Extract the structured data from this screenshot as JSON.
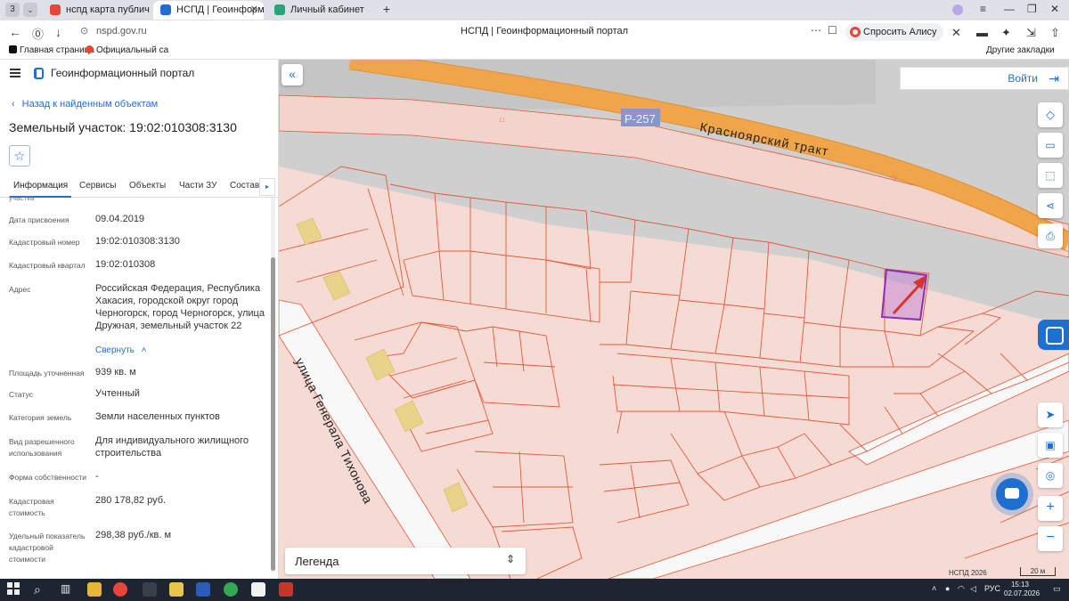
{
  "browser": {
    "tab_count": "3",
    "tabs": [
      {
        "label": "нспд карта публичная кад",
        "active": false
      },
      {
        "label": "НСПД | Геоинформаци",
        "active": true
      },
      {
        "label": "Личный кабинет",
        "active": false
      }
    ],
    "url": "nspd.gov.ru",
    "page_title": "НСПД | Геоинформационный портал",
    "alice_label": "Спросить Алису AI",
    "bookmarks": [
      {
        "label": "Главная страница"
      },
      {
        "label": "Официальный са"
      }
    ],
    "other_bookmarks": "Другие закладки"
  },
  "panel": {
    "portal_title": "Геоинформационный портал",
    "back_link": "Назад к найденным объектам",
    "parcel_title": "Земельный участок: 19:02:010308:3130",
    "tabs": [
      "Информация",
      "Сервисы",
      "Объекты",
      "Части ЗУ",
      "Состав"
    ],
    "clipped_label": "участка",
    "fields": [
      {
        "label": "Дата присвоения",
        "value": "09.04.2019"
      },
      {
        "label": "Кадастровый номер",
        "value": "19:02:010308:3130"
      },
      {
        "label": "Кадастровый квартал",
        "value": "19:02:010308"
      },
      {
        "label": "Адрес",
        "value": "Российская Федерация, Республика Хакасия, городской округ город Черногорск, город Черногорск, улица Дружная, земельный участок 22"
      },
      {
        "label": "Площадь уточненная",
        "value": "939 кв. м"
      },
      {
        "label": "Статус",
        "value": "Учтенный"
      },
      {
        "label": "Категория земель",
        "value": "Земли населенных пунктов"
      },
      {
        "label": "Вид разрешенного использования",
        "value": "Для индивидуального жилищного строительства"
      },
      {
        "label": "Форма собственности",
        "value": "-"
      },
      {
        "label": "Кадастровая стоимость",
        "value": "280 178,82 руб."
      },
      {
        "label": "Удельный показатель кадастровой стоимости",
        "value": "298,38 руб./кв. м"
      }
    ],
    "collapse_label": "Свернуть"
  },
  "map": {
    "login_label": "Войти",
    "road_badge": "Р-257",
    "road_name": "Красноярский тракт",
    "street_name": "улица Генерала Тихонова",
    "legend_label": "Легенда",
    "copyright": "НСПД 2026",
    "scale": "20 м",
    "colors": {
      "parcel_line": "#e05a3c",
      "parcel_fill": "#f6dbd5",
      "road": "#f0a54a",
      "highlight": "#8a2fb8",
      "building": "#e8d38a",
      "accent": "#1f6fd1"
    }
  },
  "taskbar": {
    "lang": "РУС",
    "time": "15:13",
    "date": "02.07.2026"
  }
}
